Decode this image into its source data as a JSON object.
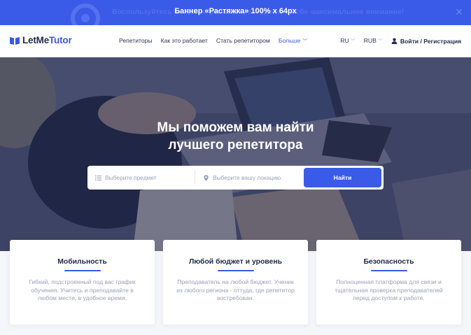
{
  "promo": {
    "text": "Баннер «Растяжка» 100% х 64рх",
    "background_text": "Воспользуйтесь услугами репетитора и уделите себе максимальное внимание!",
    "close_icon": "close-icon",
    "color": "#3a5ae8"
  },
  "header": {
    "logo_main": "LetMe",
    "logo_accent": "Tutor",
    "nav": [
      {
        "label": "Репетиторы"
      },
      {
        "label": "Как это работает"
      },
      {
        "label": "Стать репетитором"
      },
      {
        "label": "Больше"
      }
    ],
    "language": "RU",
    "currency": "RUB",
    "login": "Войти / Регистрация"
  },
  "hero": {
    "title_line1": "Мы поможем вам найти",
    "title_line2": "лучшего репетитора",
    "search": {
      "subject_placeholder": "Выберите предмет",
      "location_placeholder": "Выберите вашу локацию",
      "button": "Найти"
    }
  },
  "features": [
    {
      "title": "Мобильность",
      "text": "Гибкий, подстроенный под вас график обучения. Учитесь и преподавайте в любом месте, в удобное время."
    },
    {
      "title": "Любой бюджет и уровень",
      "text": "Преподаватель на любой бюджет. Ученик из любого региона - оттуда, где репетитор востребован."
    },
    {
      "title": "Безопасность",
      "text": "Полноценная платформа для связи и тщательная проверка преподавателей перед доступом к работе."
    }
  ],
  "colors": {
    "accent": "#3a5ae8",
    "heading": "#1e2a4a",
    "muted": "#9aa2b8"
  }
}
